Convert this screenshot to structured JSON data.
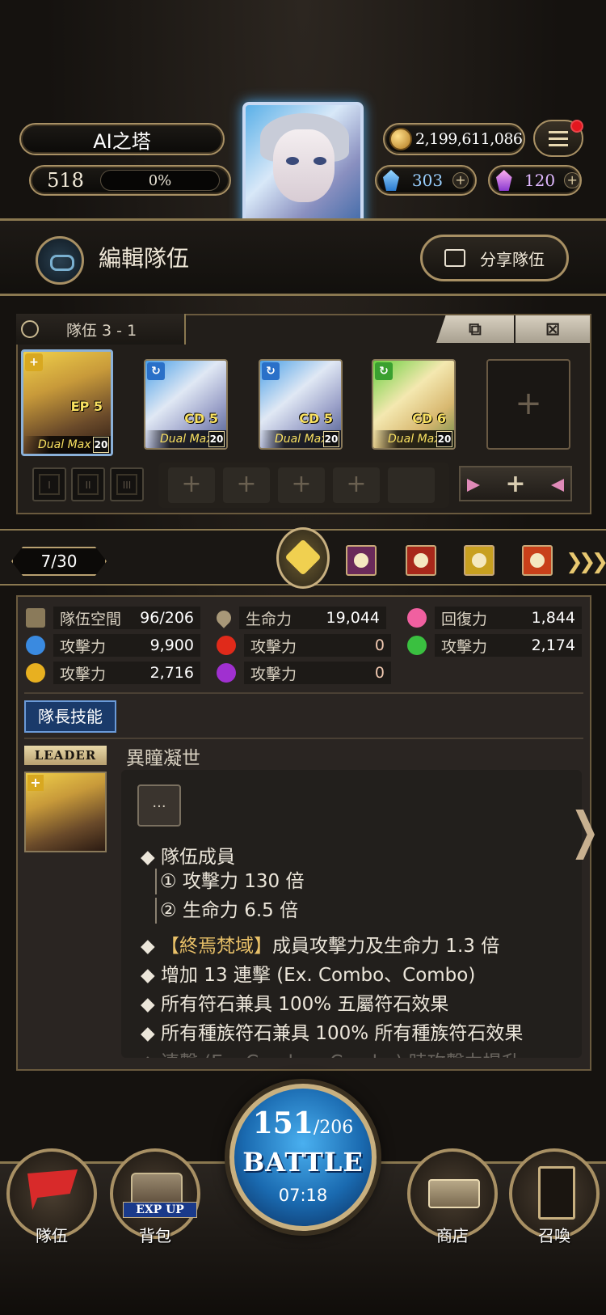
{
  "header": {
    "stage_title": "AI之塔",
    "player_level": "518",
    "exp_percent": "0%",
    "coins": "2,199,611,086",
    "diamonds": "303",
    "soul_crystals": "120",
    "has_notification": true
  },
  "edit_team": {
    "title": "編輯隊伍",
    "share_label": "分享隊伍"
  },
  "team": {
    "label": "隊伍 3 - 1",
    "members": [
      {
        "badge": "EP 5",
        "dual": "Dual Max",
        "level": "20",
        "leader": true
      },
      {
        "badge": "CD 5",
        "dual": "Dual Max",
        "level": "20"
      },
      {
        "badge": "CD 5",
        "dual": "Dual Max",
        "level": "20"
      },
      {
        "badge": "CD 6",
        "dual": "Dual Max",
        "level": "20"
      }
    ],
    "craft_slots": [
      "I",
      "II",
      "III"
    ]
  },
  "filter": {
    "count": "7/30"
  },
  "stats": {
    "team_space_label": "隊伍空間",
    "team_space": "96/206",
    "hp_label": "生命力",
    "hp": "19,044",
    "recovery_label": "回復力",
    "recovery": "1,844",
    "atk_water_label": "攻擊力",
    "atk_water": "9,900",
    "atk_fire_label": "攻擊力",
    "atk_fire": "0",
    "atk_wood_label": "攻擊力",
    "atk_wood": "2,174",
    "atk_light_label": "攻擊力",
    "atk_light": "2,716",
    "atk_dark_label": "攻擊力",
    "atk_dark": "0"
  },
  "leader_skill": {
    "button": "隊長技能",
    "tag": "LEADER",
    "name": "異瞳凝世",
    "more": "...",
    "lines": {
      "l1": "◆ 隊伍成員",
      "l2": "① 攻擊力 130 倍",
      "l3": "② 生命力 6.5 倍",
      "l4_pre": "◆ ",
      "l4_hl": "【終焉梵域】",
      "l4_post": "成員攻擊力及生命力 1.3 倍",
      "l5": "◆ 增加 13 連擊 (Ex. Combo、Combo)",
      "l6": "◆ 所有符石兼具 100% 五屬符石效果",
      "l7": "◆ 所有種族符石兼具 100% 所有種族符石效果",
      "l8": "◆ 連擊 (Ex. Combo、Combo) 時攻擊力提升"
    }
  },
  "nav": {
    "team": "隊伍",
    "bag": "背包",
    "exp_up": "EXP UP",
    "shop": "商店",
    "summon": "召喚",
    "battle_stamina": "151",
    "battle_stamina_max": "/206",
    "battle_label": "BATTLE",
    "battle_timer": "07:18"
  }
}
